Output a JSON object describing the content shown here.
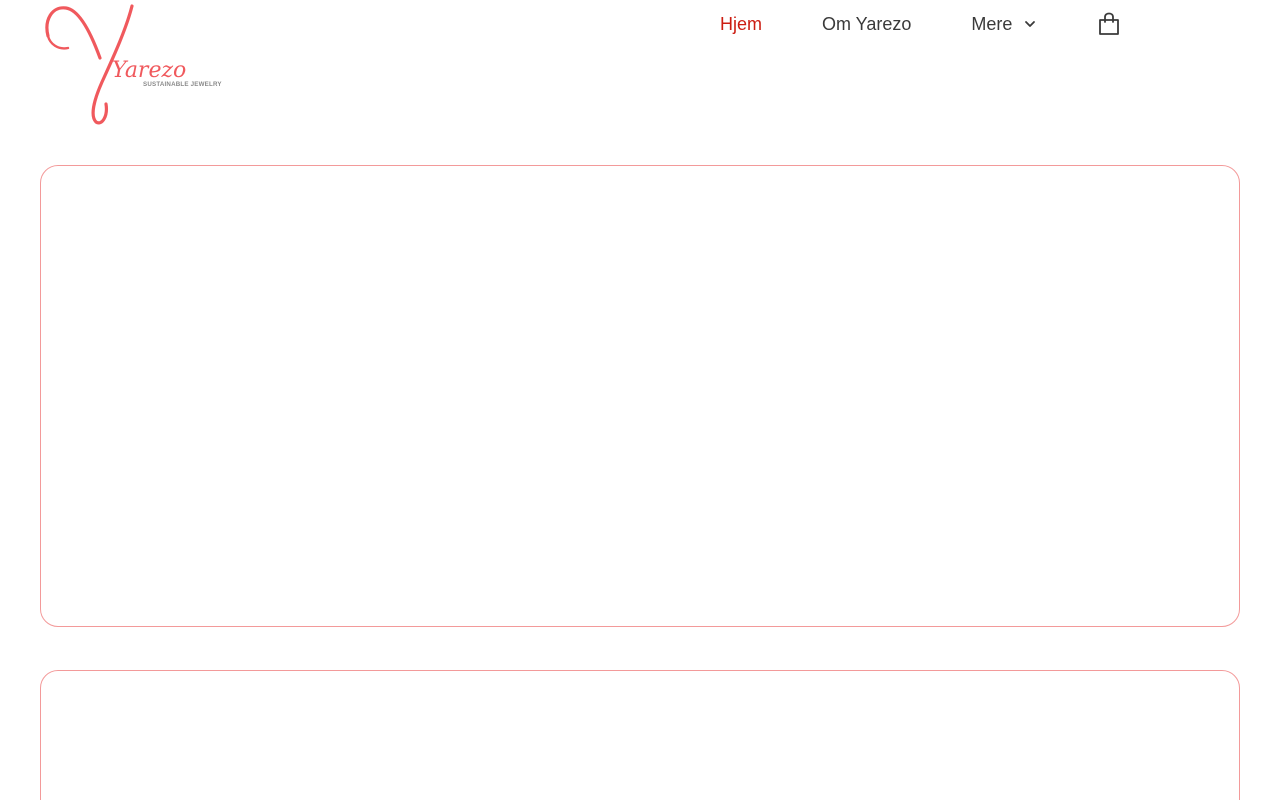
{
  "brand": {
    "name": "Yarezo",
    "tagline": "SUSTAINABLE JEWELRY",
    "color": "#f0595d"
  },
  "nav": {
    "items": [
      {
        "label": "Hjem",
        "active": true
      },
      {
        "label": "Om Yarezo",
        "active": false
      },
      {
        "label": "Mere",
        "active": false,
        "has_dropdown": true
      }
    ],
    "active_color": "#cc1d12",
    "cart_icon": "shopping-bag-icon"
  },
  "cards": {
    "border_color": "#f39a9a"
  }
}
